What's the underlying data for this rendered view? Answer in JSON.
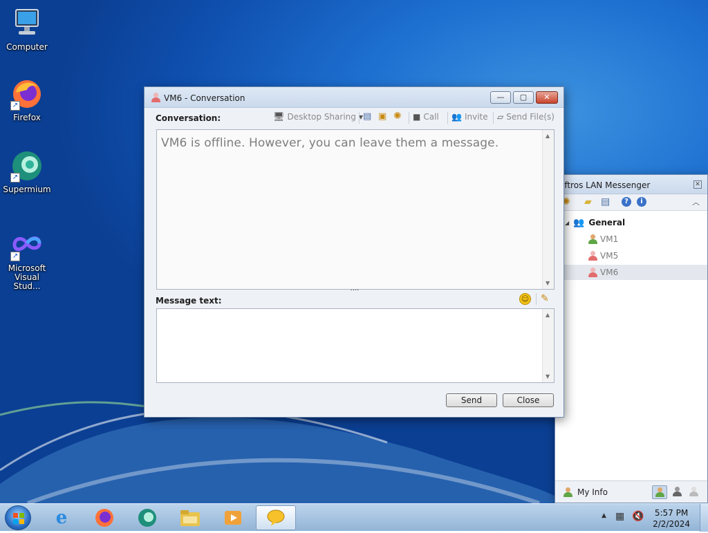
{
  "desktop": {
    "icons": [
      {
        "label": "Computer"
      },
      {
        "label": "Firefox"
      },
      {
        "label": "Supermium"
      },
      {
        "label": "Microsoft\nVisual Stud..."
      }
    ]
  },
  "conversation": {
    "title": "VM6 - Conversation",
    "conversation_label": "Conversation:",
    "toolbar": {
      "desktop_sharing": "Desktop Sharing",
      "call": "Call",
      "invite": "Invite",
      "send_files": "Send File(s)"
    },
    "history_text": "VM6 is offline. However, you can leave them a message.",
    "message_label": "Message text:",
    "message_value": "",
    "send_label": "Send",
    "close_label": "Close"
  },
  "messenger": {
    "title": "oftros LAN Messenger",
    "group": "General",
    "contacts": [
      {
        "name": "VM1",
        "status_color": "#e07a2a"
      },
      {
        "name": "VM5",
        "status_color": "#d45a5a"
      },
      {
        "name": "VM6",
        "status_color": "#d45a5a"
      }
    ],
    "my_info_label": "My Info"
  },
  "taskbar": {
    "time": "5:57 PM",
    "date": "2/2/2024"
  }
}
